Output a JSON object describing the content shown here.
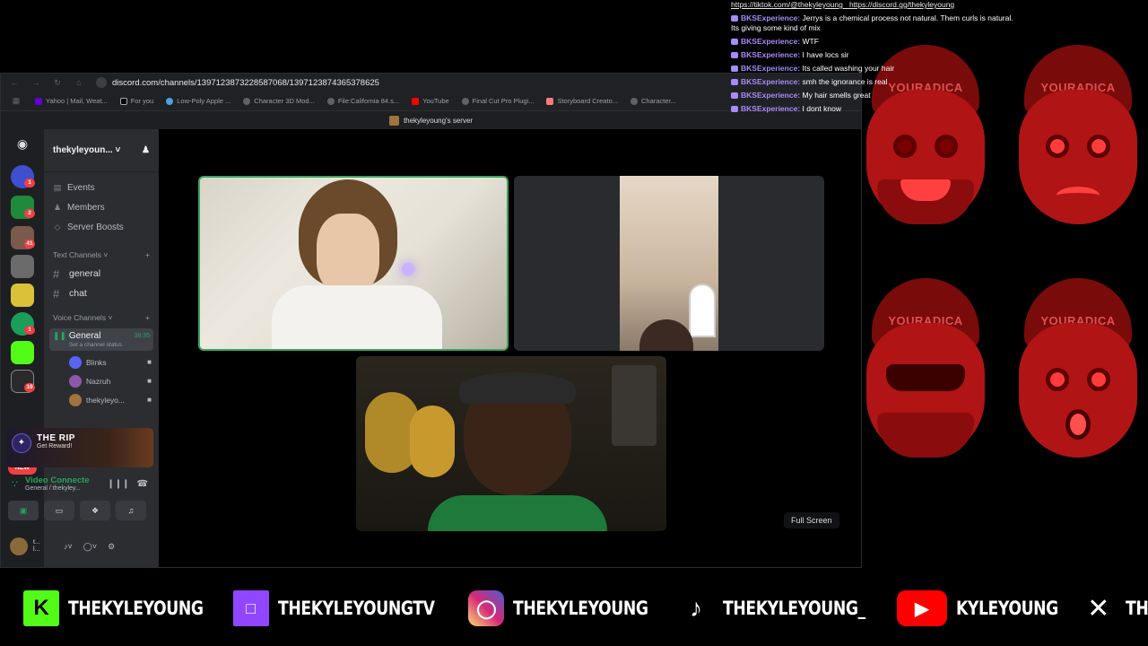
{
  "chat": {
    "top_links": [
      "https://tiktok.com/@thekyleyoung_",
      "https://discord.gg/thekyleyoung"
    ],
    "messages": [
      {
        "user": "BKSExperience:",
        "text": "Jerrys is a chemical process not natural. Them curls is natural. Its giving some kind of mix"
      },
      {
        "user": "BKSExperience:",
        "text": "WTF"
      },
      {
        "user": "BKSExperience:",
        "text": "I have locs sir"
      },
      {
        "user": "BKSExperience:",
        "text": "Its called washing your hair"
      },
      {
        "user": "BKSExperience:",
        "text": "smh the ignorance is real"
      },
      {
        "user": "BKSExperience:",
        "text": "My hair smells great"
      },
      {
        "user": "BKSExperience:",
        "text": "I dont know"
      }
    ]
  },
  "wall": {
    "cap_text": "YOURADICA"
  },
  "browser": {
    "url": "discord.com/channels/1397123873228587068/1397123874365378625",
    "bookmarks": [
      "Yahoo | Mail, Weat...",
      "For you",
      "Low-Poly Apple ...",
      "Character 3D Mod...",
      "File:California 84.s...",
      "YouTube",
      "Final Cut Pro Plugi...",
      "Storyboard Creato...",
      "Character..."
    ],
    "tab_title": "thekyleyoung's server"
  },
  "rail": {
    "badges": [
      "1",
      "2",
      "41",
      "1",
      "10"
    ],
    "new_label": "NEW"
  },
  "sidebar": {
    "server_name": "thekyleyoun...",
    "items": [
      {
        "label": "Events",
        "icon": "calendar-icon"
      },
      {
        "label": "Members",
        "icon": "members-icon"
      },
      {
        "label": "Server Boosts",
        "icon": "boost-icon"
      }
    ],
    "text_category": "Text Channels",
    "text_channels": [
      "general",
      "chat"
    ],
    "voice_category": "Voice Channels",
    "voice_channel": {
      "name": "General",
      "time": "38:35",
      "status": "Set a channel status"
    },
    "members": [
      "Blinks",
      "Nazruh",
      "thekyleyo..."
    ]
  },
  "promo": {
    "title": "THE RIP",
    "subtitle": "Get Reward!"
  },
  "voice": {
    "title": "Video Connecte",
    "subtitle": "General / thekyley..."
  },
  "userbar": {
    "name": "t...",
    "status": "l..."
  },
  "video": {
    "fullscreen_label": "Full Screen"
  },
  "footer": {
    "socials": [
      {
        "platform": "kick",
        "handle": "THEKYLEYOUNG",
        "color": "#53fc18"
      },
      {
        "platform": "twitch",
        "handle": "THEKYLEYOUNGTV",
        "color": "#9146ff"
      },
      {
        "platform": "instagram",
        "handle": "THEKYLEYOUNG",
        "color": "#e1306c"
      },
      {
        "platform": "tiktok",
        "handle": "THEKYLEYOUNG_",
        "color": "#ffffff"
      },
      {
        "platform": "youtube",
        "handle": "KYLEYOUNG",
        "color": "#ff0000"
      },
      {
        "platform": "x",
        "handle": "THEKYLEYOUNG",
        "color": "#ffffff"
      }
    ]
  }
}
